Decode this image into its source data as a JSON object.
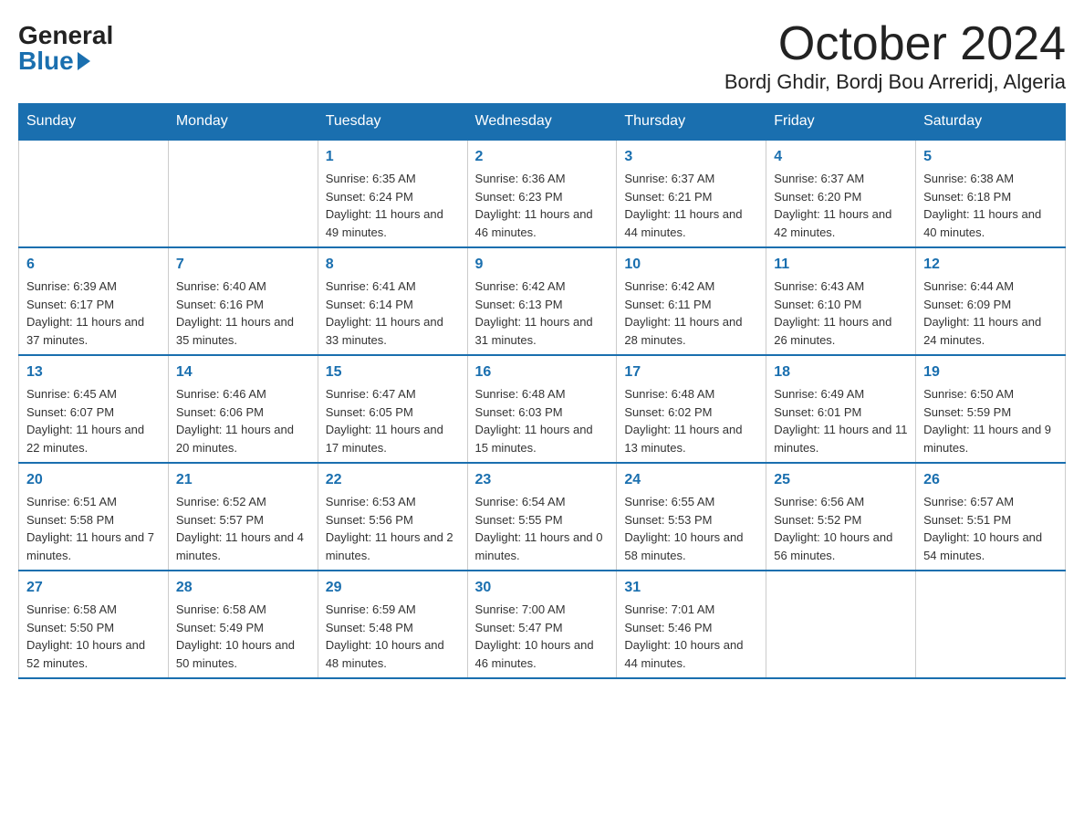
{
  "header": {
    "logo_general": "General",
    "logo_blue": "Blue",
    "month_title": "October 2024",
    "location": "Bordj Ghdir, Bordj Bou Arreridj, Algeria"
  },
  "days_of_week": [
    "Sunday",
    "Monday",
    "Tuesday",
    "Wednesday",
    "Thursday",
    "Friday",
    "Saturday"
  ],
  "weeks": [
    [
      {
        "day": "",
        "sunrise": "",
        "sunset": "",
        "daylight": ""
      },
      {
        "day": "",
        "sunrise": "",
        "sunset": "",
        "daylight": ""
      },
      {
        "day": "1",
        "sunrise": "Sunrise: 6:35 AM",
        "sunset": "Sunset: 6:24 PM",
        "daylight": "Daylight: 11 hours and 49 minutes."
      },
      {
        "day": "2",
        "sunrise": "Sunrise: 6:36 AM",
        "sunset": "Sunset: 6:23 PM",
        "daylight": "Daylight: 11 hours and 46 minutes."
      },
      {
        "day": "3",
        "sunrise": "Sunrise: 6:37 AM",
        "sunset": "Sunset: 6:21 PM",
        "daylight": "Daylight: 11 hours and 44 minutes."
      },
      {
        "day": "4",
        "sunrise": "Sunrise: 6:37 AM",
        "sunset": "Sunset: 6:20 PM",
        "daylight": "Daylight: 11 hours and 42 minutes."
      },
      {
        "day": "5",
        "sunrise": "Sunrise: 6:38 AM",
        "sunset": "Sunset: 6:18 PM",
        "daylight": "Daylight: 11 hours and 40 minutes."
      }
    ],
    [
      {
        "day": "6",
        "sunrise": "Sunrise: 6:39 AM",
        "sunset": "Sunset: 6:17 PM",
        "daylight": "Daylight: 11 hours and 37 minutes."
      },
      {
        "day": "7",
        "sunrise": "Sunrise: 6:40 AM",
        "sunset": "Sunset: 6:16 PM",
        "daylight": "Daylight: 11 hours and 35 minutes."
      },
      {
        "day": "8",
        "sunrise": "Sunrise: 6:41 AM",
        "sunset": "Sunset: 6:14 PM",
        "daylight": "Daylight: 11 hours and 33 minutes."
      },
      {
        "day": "9",
        "sunrise": "Sunrise: 6:42 AM",
        "sunset": "Sunset: 6:13 PM",
        "daylight": "Daylight: 11 hours and 31 minutes."
      },
      {
        "day": "10",
        "sunrise": "Sunrise: 6:42 AM",
        "sunset": "Sunset: 6:11 PM",
        "daylight": "Daylight: 11 hours and 28 minutes."
      },
      {
        "day": "11",
        "sunrise": "Sunrise: 6:43 AM",
        "sunset": "Sunset: 6:10 PM",
        "daylight": "Daylight: 11 hours and 26 minutes."
      },
      {
        "day": "12",
        "sunrise": "Sunrise: 6:44 AM",
        "sunset": "Sunset: 6:09 PM",
        "daylight": "Daylight: 11 hours and 24 minutes."
      }
    ],
    [
      {
        "day": "13",
        "sunrise": "Sunrise: 6:45 AM",
        "sunset": "Sunset: 6:07 PM",
        "daylight": "Daylight: 11 hours and 22 minutes."
      },
      {
        "day": "14",
        "sunrise": "Sunrise: 6:46 AM",
        "sunset": "Sunset: 6:06 PM",
        "daylight": "Daylight: 11 hours and 20 minutes."
      },
      {
        "day": "15",
        "sunrise": "Sunrise: 6:47 AM",
        "sunset": "Sunset: 6:05 PM",
        "daylight": "Daylight: 11 hours and 17 minutes."
      },
      {
        "day": "16",
        "sunrise": "Sunrise: 6:48 AM",
        "sunset": "Sunset: 6:03 PM",
        "daylight": "Daylight: 11 hours and 15 minutes."
      },
      {
        "day": "17",
        "sunrise": "Sunrise: 6:48 AM",
        "sunset": "Sunset: 6:02 PM",
        "daylight": "Daylight: 11 hours and 13 minutes."
      },
      {
        "day": "18",
        "sunrise": "Sunrise: 6:49 AM",
        "sunset": "Sunset: 6:01 PM",
        "daylight": "Daylight: 11 hours and 11 minutes."
      },
      {
        "day": "19",
        "sunrise": "Sunrise: 6:50 AM",
        "sunset": "Sunset: 5:59 PM",
        "daylight": "Daylight: 11 hours and 9 minutes."
      }
    ],
    [
      {
        "day": "20",
        "sunrise": "Sunrise: 6:51 AM",
        "sunset": "Sunset: 5:58 PM",
        "daylight": "Daylight: 11 hours and 7 minutes."
      },
      {
        "day": "21",
        "sunrise": "Sunrise: 6:52 AM",
        "sunset": "Sunset: 5:57 PM",
        "daylight": "Daylight: 11 hours and 4 minutes."
      },
      {
        "day": "22",
        "sunrise": "Sunrise: 6:53 AM",
        "sunset": "Sunset: 5:56 PM",
        "daylight": "Daylight: 11 hours and 2 minutes."
      },
      {
        "day": "23",
        "sunrise": "Sunrise: 6:54 AM",
        "sunset": "Sunset: 5:55 PM",
        "daylight": "Daylight: 11 hours and 0 minutes."
      },
      {
        "day": "24",
        "sunrise": "Sunrise: 6:55 AM",
        "sunset": "Sunset: 5:53 PM",
        "daylight": "Daylight: 10 hours and 58 minutes."
      },
      {
        "day": "25",
        "sunrise": "Sunrise: 6:56 AM",
        "sunset": "Sunset: 5:52 PM",
        "daylight": "Daylight: 10 hours and 56 minutes."
      },
      {
        "day": "26",
        "sunrise": "Sunrise: 6:57 AM",
        "sunset": "Sunset: 5:51 PM",
        "daylight": "Daylight: 10 hours and 54 minutes."
      }
    ],
    [
      {
        "day": "27",
        "sunrise": "Sunrise: 6:58 AM",
        "sunset": "Sunset: 5:50 PM",
        "daylight": "Daylight: 10 hours and 52 minutes."
      },
      {
        "day": "28",
        "sunrise": "Sunrise: 6:58 AM",
        "sunset": "Sunset: 5:49 PM",
        "daylight": "Daylight: 10 hours and 50 minutes."
      },
      {
        "day": "29",
        "sunrise": "Sunrise: 6:59 AM",
        "sunset": "Sunset: 5:48 PM",
        "daylight": "Daylight: 10 hours and 48 minutes."
      },
      {
        "day": "30",
        "sunrise": "Sunrise: 7:00 AM",
        "sunset": "Sunset: 5:47 PM",
        "daylight": "Daylight: 10 hours and 46 minutes."
      },
      {
        "day": "31",
        "sunrise": "Sunrise: 7:01 AM",
        "sunset": "Sunset: 5:46 PM",
        "daylight": "Daylight: 10 hours and 44 minutes."
      },
      {
        "day": "",
        "sunrise": "",
        "sunset": "",
        "daylight": ""
      },
      {
        "day": "",
        "sunrise": "",
        "sunset": "",
        "daylight": ""
      }
    ]
  ]
}
